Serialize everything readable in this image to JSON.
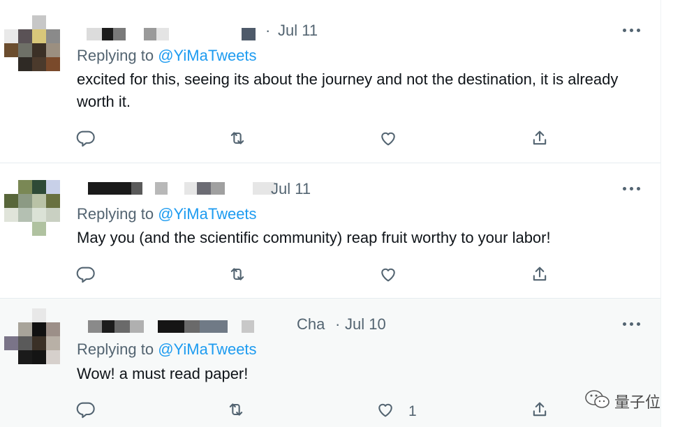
{
  "tweets": [
    {
      "date": "Jul 11",
      "handle_fragment": "",
      "replying_prefix": "Replying to",
      "mention": "@YiMaTweets",
      "text": "excited for this, seeing its about the journey and not the destination, it is already worth it.",
      "like_count": ""
    },
    {
      "date": "Jul 11",
      "handle_fragment": "",
      "replying_prefix": "Replying to",
      "mention": "@YiMaTweets",
      "text": "May you (and the scientific community) reap fruit worthy to your labor!",
      "like_count": ""
    },
    {
      "date": "Jul 10",
      "handle_fragment": "Cha",
      "replying_prefix": "Replying to",
      "mention": "@YiMaTweets",
      "text": "Wow! a must read paper!",
      "like_count": "1"
    }
  ],
  "separator": "·",
  "icons": {
    "more": "more-dots-icon",
    "reply": "reply-bubble-icon",
    "retweet": "retweet-arrows-icon",
    "like": "heart-icon",
    "share": "share-upload-icon"
  },
  "watermark": {
    "text": "量子位"
  },
  "colors": {
    "text": "#0f1419",
    "secondary": "#536471",
    "mention": "#1d9bf0",
    "divider": "#e6ecf0",
    "hover_bg": "#f7f9f9"
  }
}
